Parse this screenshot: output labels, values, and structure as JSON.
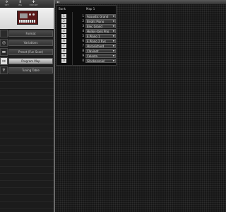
{
  "toolbar": {
    "tools": [
      {
        "icon": "gear-icon",
        "glyph": "✲",
        "label": "SET"
      },
      {
        "icon": "download-icon",
        "glyph": "⬇",
        "label": "INS"
      },
      {
        "icon": "export-icon",
        "glyph": "✚",
        "label": "EXPORT"
      },
      {
        "icon": "blank-tool-icon",
        "glyph": "",
        "label": ""
      }
    ]
  },
  "sidebar": {
    "items": [
      {
        "icon": "format-icon",
        "glyph": "",
        "label": "Format"
      },
      {
        "icon": "variations-icon",
        "glyph": "◎",
        "label": "Variations"
      },
      {
        "icon": "preset-icon",
        "glyph": "▬",
        "label": "Preset (Fun Scan)"
      },
      {
        "icon": "program-map-icon",
        "glyph": "⚏",
        "label": "Program Map"
      },
      {
        "icon": "tuning-icon",
        "glyph": "♆",
        "label": "Tuning Table"
      }
    ]
  },
  "program_map": {
    "col1_header": "Bank",
    "col2_header": "Map 1",
    "rows": [
      {
        "slot": "1",
        "num": "1",
        "program": "Acoustic Grand"
      },
      {
        "slot": "2",
        "num": "2",
        "program": "Bright Piano"
      },
      {
        "slot": "3",
        "num": "3",
        "program": "Elec Grand"
      },
      {
        "slot": "4",
        "num": "4",
        "program": "Honky-tonk Pno"
      },
      {
        "slot": "5",
        "num": "5",
        "program": "E.Piano 1"
      },
      {
        "slot": "6",
        "num": "6",
        "program": "E.Piano 2 Rvs"
      },
      {
        "slot": "7",
        "num": "7",
        "program": "Harpsichord"
      },
      {
        "slot": "8",
        "num": "8",
        "program": "Clavinet"
      },
      {
        "slot": "9",
        "num": "9",
        "program": "Celesta"
      },
      {
        "slot": "0",
        "num": "0",
        "program": "Glockenspiel"
      }
    ]
  }
}
